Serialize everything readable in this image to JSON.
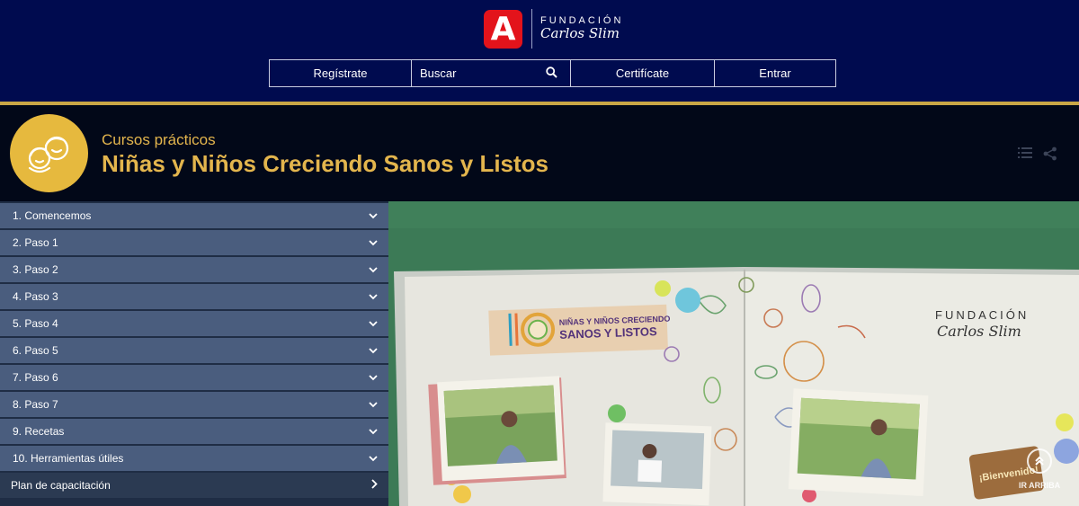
{
  "brand": {
    "logo_letter": "A",
    "org_line1": "FUNDACIÓN",
    "org_line2": "Carlos Slim"
  },
  "nav": {
    "register_label": "Regístrate",
    "search_placeholder": "Buscar",
    "certificate_label": "Certifícate",
    "login_label": "Entrar"
  },
  "course": {
    "category": "Cursos prácticos",
    "title": "Niñas y Niños Creciendo Sanos y Listos"
  },
  "sidebar": {
    "items": [
      {
        "label": "1. Comencemos"
      },
      {
        "label": "2. Paso 1"
      },
      {
        "label": "3. Paso 2"
      },
      {
        "label": "4. Paso 3"
      },
      {
        "label": "5. Paso 4"
      },
      {
        "label": "6. Paso 5"
      },
      {
        "label": "7. Paso 6"
      },
      {
        "label": "8. Paso 7"
      },
      {
        "label": "9. Recetas"
      },
      {
        "label": "10. Herramientas útiles"
      }
    ],
    "plan_label": "Plan de capacitación"
  },
  "video": {
    "course_logo_line1": "NIÑAS Y NIÑOS CRECIENDO",
    "course_logo_line2": "SANOS Y LISTOS",
    "foundation_line1": "FUNDACIÓN",
    "foundation_line2": "Carlos Slim",
    "welcome_tag": "¡Bienvenido!"
  },
  "scroll_top": {
    "label": "IR ARRIBA"
  },
  "colors": {
    "header_bg": "#000b4f",
    "accent_gold": "#c9a646",
    "title_gold": "#e3b54d",
    "sidebar_item": "#4a5d7e",
    "logo_red": "#e3131b"
  }
}
